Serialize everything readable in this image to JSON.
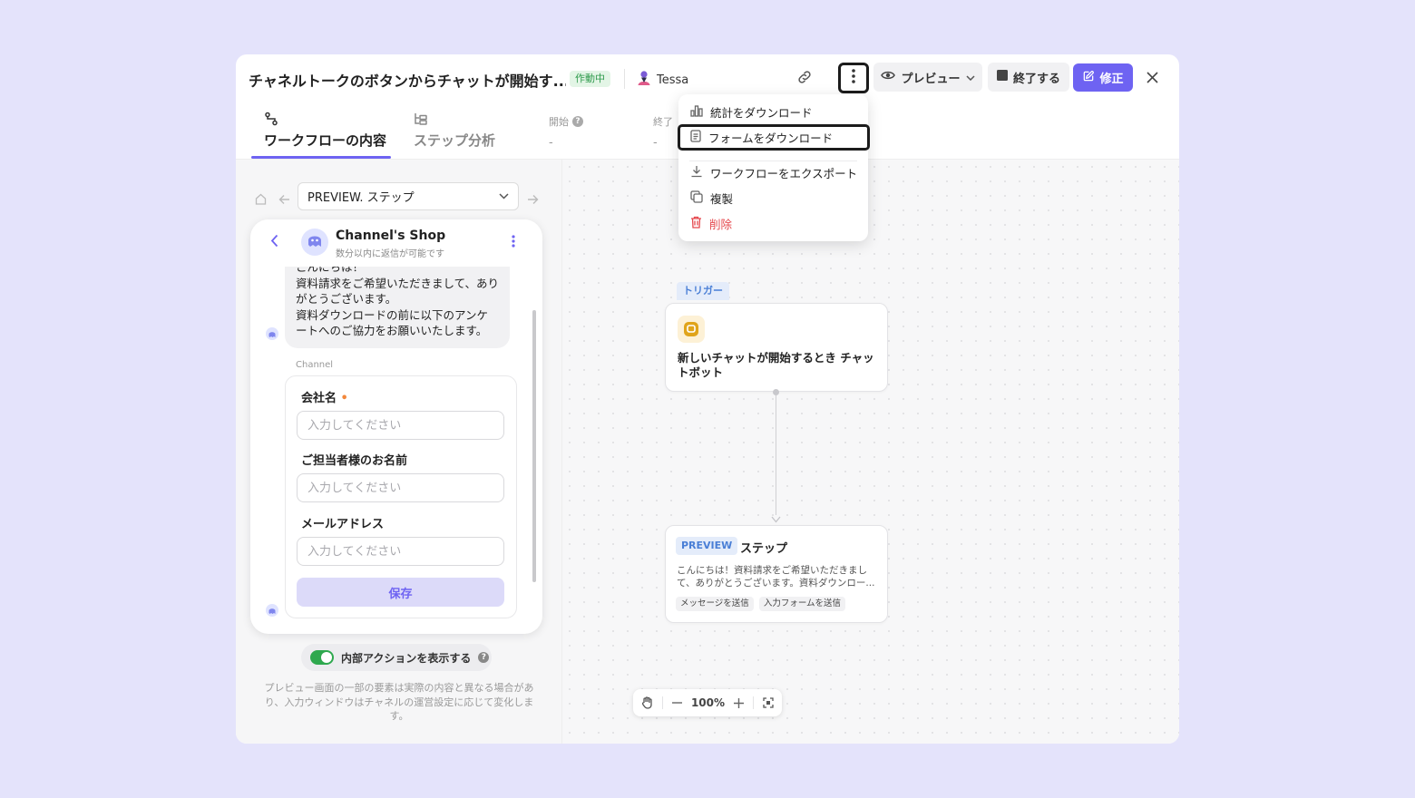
{
  "header": {
    "title": "チャネルトークのボタンからチャットが開始す...",
    "status_badge": "作動中",
    "user_name": "Tessa",
    "preview_label": "プレビュー",
    "end_label": "終了する",
    "edit_label": "修正"
  },
  "tabs": {
    "content_label": "ワークフローの内容",
    "analysis_label": "ステップ分析",
    "start_label": "開始",
    "start_value": "-",
    "end_label": "終了",
    "end_value": "-"
  },
  "menu": {
    "items": [
      {
        "label": "統計をダウンロード",
        "icon": "bar-chart-icon"
      },
      {
        "label": "フォームをダウンロード",
        "icon": "document-icon"
      },
      {
        "label": "ワークフローをエクスポート",
        "icon": "download-icon"
      },
      {
        "label": "複製",
        "icon": "copy-icon"
      },
      {
        "label": "削除",
        "icon": "trash-icon"
      }
    ]
  },
  "preview_panel": {
    "step_select": "PREVIEW. ステップ",
    "shop_name": "Channel's Shop",
    "shop_status": "数分以内に返信が可能です",
    "message": "こんにちは！\n資料請求をご希望いただきまして、ありがとうございます。\n資料ダウンロードの前に以下のアンケートへのご協力をお願いいたします。",
    "channel_label": "Channel",
    "form": {
      "fields": [
        {
          "label": "会社名",
          "required": true,
          "placeholder": "入力してください"
        },
        {
          "label": "ご担当者様のお名前",
          "required": false,
          "placeholder": "入力してください"
        },
        {
          "label": "メールアドレス",
          "required": false,
          "placeholder": "入力してください"
        }
      ],
      "save_label": "保存"
    },
    "toggle_label": "内部アクションを表示する",
    "toggle_on": true,
    "note": "プレビュー画面の一部の要素は実際の内容と異なる場合があり、入力ウィンドウはチャネルの運営設定に応じて変化します。"
  },
  "canvas": {
    "trigger_tag": "トリガー",
    "trigger_text": "新しいチャットが開始するとき チャットボット",
    "step_tag": "PREVIEW",
    "step_title": "ステップ",
    "step_desc": "こんにちは！資料請求をご希望いただきまして、ありがとうございます。資料ダウンロー...",
    "chips": [
      "メッセージを送信",
      "入力フォームを送信"
    ],
    "zoom": "100%"
  },
  "colors": {
    "accent": "#6e63f2",
    "running": "#2e9a4c",
    "danger": "#e5484d",
    "tag_blue": "#4a7fd6",
    "background": "#e4e3fb"
  }
}
